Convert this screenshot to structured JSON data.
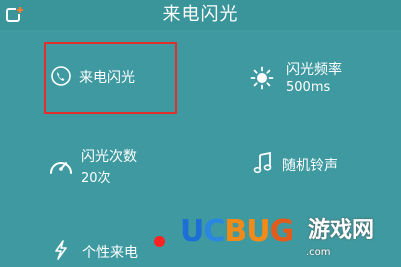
{
  "header": {
    "title": "来电闪光",
    "back_icon": "back-add-icon"
  },
  "settings": {
    "flash_toggle": {
      "label": "来电闪光",
      "icon": "phone-ring-icon"
    },
    "flash_frequency": {
      "label": "闪光频率",
      "value": "500ms",
      "icon": "sun-icon"
    },
    "flash_count": {
      "label": "闪光次数",
      "value": "20次",
      "icon": "gauge-icon"
    },
    "random_ringtone": {
      "label": "随机铃声",
      "icon": "music-note-icon"
    },
    "custom_call": {
      "label": "个性来电",
      "icon": "lightning-icon"
    }
  },
  "watermark": {
    "logo_parts": [
      "U",
      "C",
      "BU",
      "G"
    ],
    "cn_text": "游戏网",
    "url": ".com"
  },
  "colors": {
    "background": "#3e9aa0",
    "highlight_border": "#e0302c",
    "badge": "#ff2222"
  }
}
